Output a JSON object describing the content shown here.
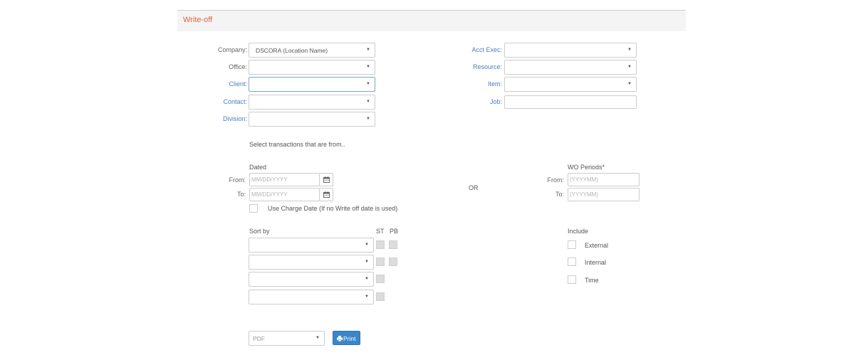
{
  "panel": {
    "title": "Write-off"
  },
  "fields_left": {
    "company": {
      "label": "Company:",
      "value": "DSCORA (Location Name)"
    },
    "office": {
      "label": "Office:",
      "value": ""
    },
    "client": {
      "label": "Client:",
      "value": ""
    },
    "contact": {
      "label": "Contact:",
      "value": ""
    },
    "division": {
      "label": "Division:",
      "value": ""
    }
  },
  "fields_right": {
    "acct_exec": {
      "label": "Acct Exec:",
      "value": ""
    },
    "resource": {
      "label": "Resource:",
      "value": ""
    },
    "item": {
      "label": "Item:",
      "value": ""
    },
    "job": {
      "label": "Job:",
      "value": ""
    }
  },
  "select_transactions": "Select transactions that are from..",
  "dated": {
    "heading": "Dated",
    "from_label": "From:",
    "to_label": "To:",
    "from_placeholder": "MM/DD/YYYY",
    "to_placeholder": "MM/DD/YYYY"
  },
  "or_label": "OR",
  "wo_periods": {
    "heading": "WO Periods*",
    "from_label": "From:",
    "to_label": "To:",
    "from_placeholder": "(YYYYMM)",
    "to_placeholder": "(YYYYMM)"
  },
  "use_charge_date": {
    "label": "Use Charge Date (If no Write off date is used)",
    "checked": false
  },
  "sort": {
    "heading": "Sort by",
    "st_label": "ST",
    "pb_label": "PB"
  },
  "include": {
    "heading": "Include",
    "items": [
      {
        "label": "External",
        "checked": false
      },
      {
        "label": "Internal",
        "checked": false
      },
      {
        "label": "Time",
        "checked": false
      }
    ]
  },
  "output": {
    "format": "PDF",
    "print_label": "Print"
  },
  "icons": {
    "calendar": "calendar-icon",
    "caret": "caret-down-icon",
    "print": "print-icon"
  },
  "colors": {
    "title": "#e0643a",
    "link": "#4a7dbd",
    "button": "#3a87c8"
  }
}
